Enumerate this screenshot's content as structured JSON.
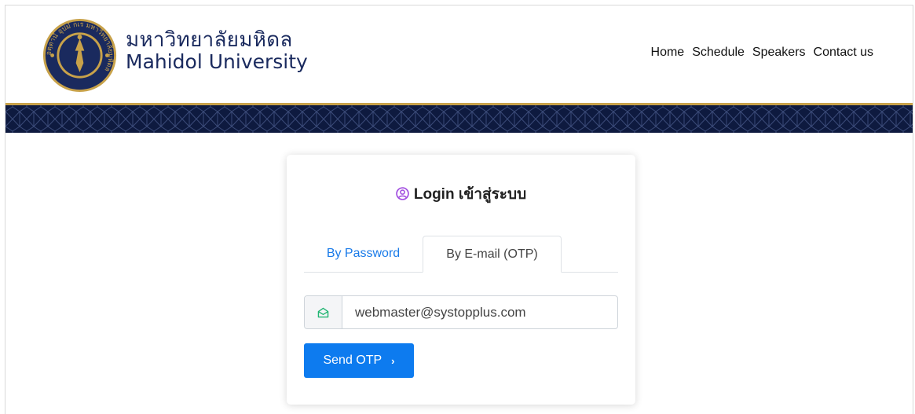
{
  "brand": {
    "name_thai": "มหาวิทยาลัยมหิดล",
    "name_english": "Mahidol University",
    "seal_text": "อตฺตานํ อุปมํ กเร มหาวิทยาลัยมหิดล",
    "colors": {
      "navy": "#1a2a5e",
      "gold": "#c8a24a",
      "band": "#0e1a3f"
    }
  },
  "nav": {
    "items": [
      {
        "label": "Home"
      },
      {
        "label": "Schedule"
      },
      {
        "label": "Speakers"
      },
      {
        "label": "Contact us"
      }
    ]
  },
  "login": {
    "title_en": "Login",
    "title_th": "เข้าสู่ระบบ",
    "icon": "user-circle-icon",
    "tabs": [
      {
        "label": "By Password",
        "active": false
      },
      {
        "label": "By E-mail (OTP)",
        "active": true
      }
    ],
    "email": {
      "value": "webmaster@systopplus.com",
      "icon": "envelope-open-icon"
    },
    "send_button": {
      "label": "Send OTP",
      "icon": "chevron-right-icon"
    },
    "colors": {
      "primary": "#0d7bef",
      "title_icon": "#a24fe0",
      "envelope_icon": "#21b573"
    }
  }
}
